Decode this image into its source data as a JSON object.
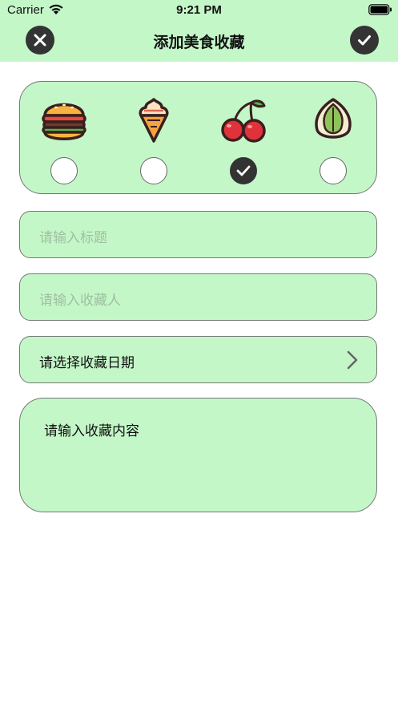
{
  "status_bar": {
    "carrier": "Carrier",
    "time": "9:21 PM",
    "wifi_icon": "wifi-icon",
    "battery_icon": "battery-icon"
  },
  "nav": {
    "title": "添加美食收藏",
    "close_icon": "close-icon",
    "confirm_icon": "check-icon"
  },
  "categories": [
    {
      "icon": "burger-icon",
      "selected": false
    },
    {
      "icon": "ice-cream-icon",
      "selected": false
    },
    {
      "icon": "cherry-icon",
      "selected": true
    },
    {
      "icon": "pistachio-icon",
      "selected": false
    }
  ],
  "form": {
    "title_placeholder": "请输入标题",
    "collector_placeholder": "请输入收藏人",
    "date_label": "请选择收藏日期",
    "content_label": "请输入收藏内容"
  },
  "colors": {
    "accent_green": "#c4f7c8",
    "dark_button": "#343434",
    "placeholder": "#9fbfa3"
  }
}
